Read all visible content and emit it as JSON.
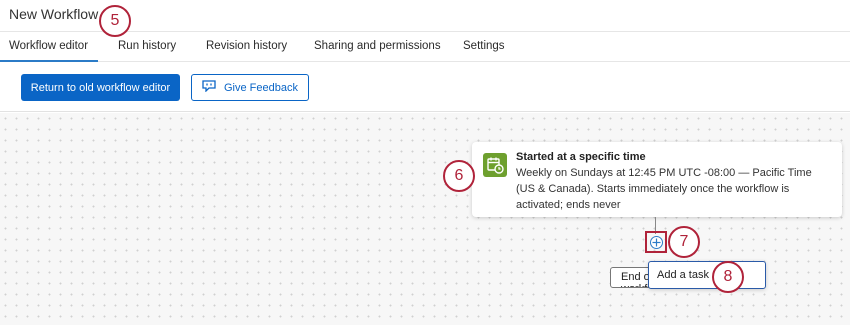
{
  "workflow": {
    "title": "New Workflow"
  },
  "tabs": [
    {
      "label": "Workflow editor",
      "active": true
    },
    {
      "label": "Run history"
    },
    {
      "label": "Revision history"
    },
    {
      "label": "Sharing and permissions"
    },
    {
      "label": "Settings"
    }
  ],
  "toolbar": {
    "return_label": "Return to old workflow editor",
    "feedback_label": "Give Feedback",
    "feedback_icon": "comment-icon"
  },
  "trigger": {
    "icon": "calendar-clock-icon",
    "title": "Started at a specific time",
    "description": "Weekly on Sundays at 12:45 PM UTC -08:00 — Pacific Time (US & Canada). Starts immediately once the workflow is activated; ends never"
  },
  "canvas": {
    "end_label": "End of workflow",
    "add_task_label": "Add a task"
  },
  "callouts": [
    "5",
    "6",
    "7",
    "8"
  ],
  "colors": {
    "primary": "#0a65c6",
    "accent_underline": "#2b7bc7",
    "trigger_icon_bg": "#6ea02e",
    "callout": "#b0233a"
  }
}
